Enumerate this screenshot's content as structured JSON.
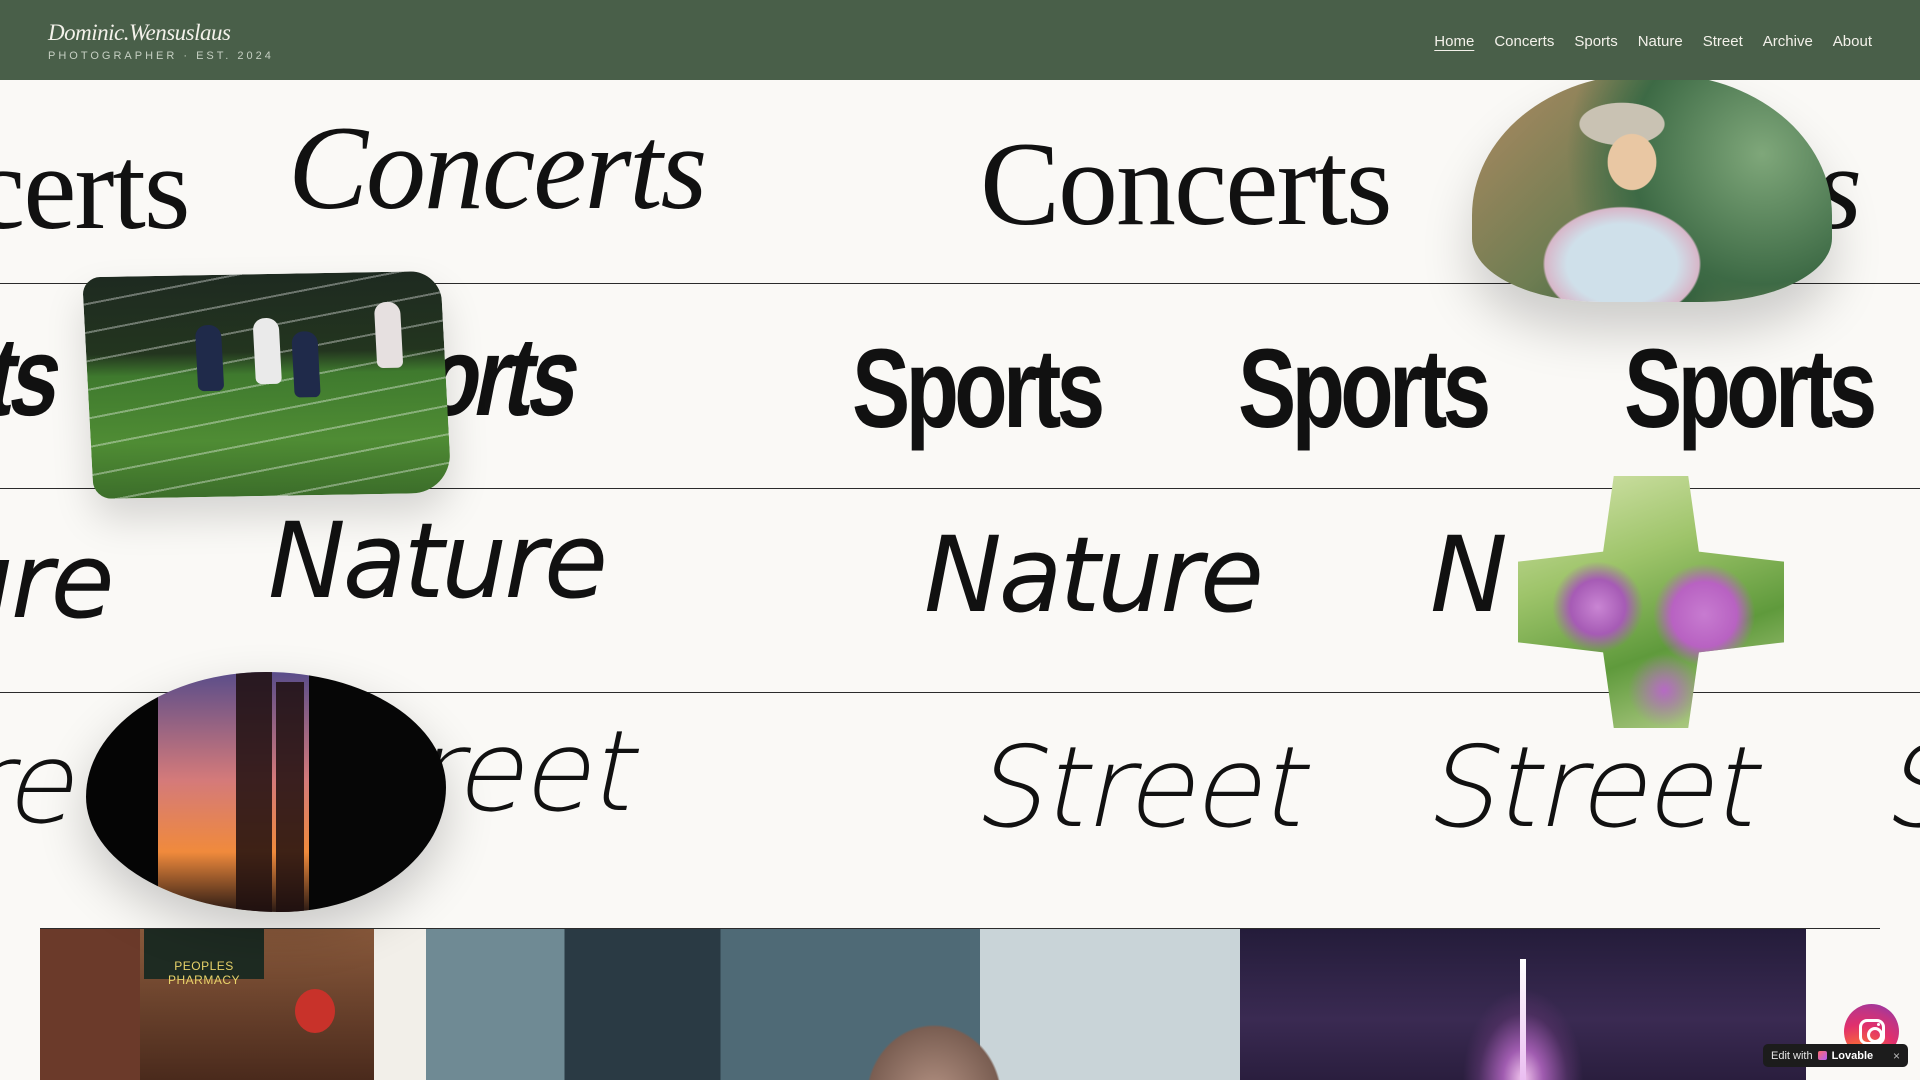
{
  "brand": {
    "name": "Dominic.Wensuslaus",
    "tagline": "PHOTOGRAPHER · EST. 2024"
  },
  "nav": {
    "items": [
      {
        "label": "Home",
        "active": true
      },
      {
        "label": "Concerts",
        "active": false
      },
      {
        "label": "Sports",
        "active": false
      },
      {
        "label": "Nature",
        "active": false
      },
      {
        "label": "Street",
        "active": false
      },
      {
        "label": "Archive",
        "active": false
      },
      {
        "label": "About",
        "active": false
      }
    ]
  },
  "rows": {
    "concerts": {
      "word": "Concerts",
      "cut_left": "certs",
      "cut_right": "ts"
    },
    "sports": {
      "word": "Sports",
      "cut_left": "rts",
      "partial": "orts"
    },
    "nature": {
      "word": "Nature",
      "cut_left": "ure",
      "partial": "N"
    },
    "street": {
      "word": "Street",
      "cut_left": "re",
      "partial": "reet",
      "cut_right": "S"
    }
  },
  "gallery": {
    "sign_text": "PEOPLES PHARMACY"
  },
  "widgets": {
    "lovable_prefix": "Edit with",
    "lovable_brand": "Lovable",
    "close_glyph": "×"
  },
  "colors": {
    "header_bg": "#495f49",
    "page_bg": "#faf9f6",
    "text": "#111111"
  },
  "icons": [
    "instagram-icon",
    "lovable-heart-icon",
    "close-icon"
  ]
}
